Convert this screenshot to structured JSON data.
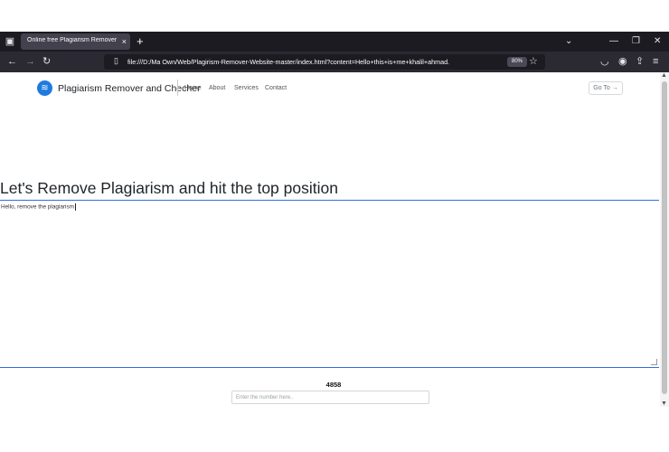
{
  "browser": {
    "tab_title": "Online free Plagiarism Remover and ...",
    "tab_close": "×",
    "new_tab": "+",
    "url": "file:///D:/Ma Own/Web/Plagirism-Remover-Website-master/index.html?content=Hello+this+is+me+khalil+ahmad.",
    "zoom": "80%",
    "icons": {
      "window": "window-icon",
      "back": "back-arrow-icon",
      "forward": "forward-arrow-icon",
      "reload": "reload-icon",
      "page": "page-icon",
      "star": "bookmark-star-icon",
      "pocket": "pocket-icon",
      "account": "account-icon",
      "extensions": "extensions-icon",
      "menu": "hamburger-menu-icon",
      "list_tabs": "chevron-down-icon"
    }
  },
  "site": {
    "brand": "Plagiarism Remover and Checher",
    "nav": [
      "Home",
      "About",
      "Services",
      "Contact"
    ],
    "goto_button": "Go To →",
    "accent_color": "#1f7ae0"
  },
  "main": {
    "headline": "Let's Remove Plagiarism and hit the top position",
    "textarea_value": "Hello, remove the plagiarism",
    "count_value": "4858",
    "number_placeholder": "Enter the number here.."
  }
}
